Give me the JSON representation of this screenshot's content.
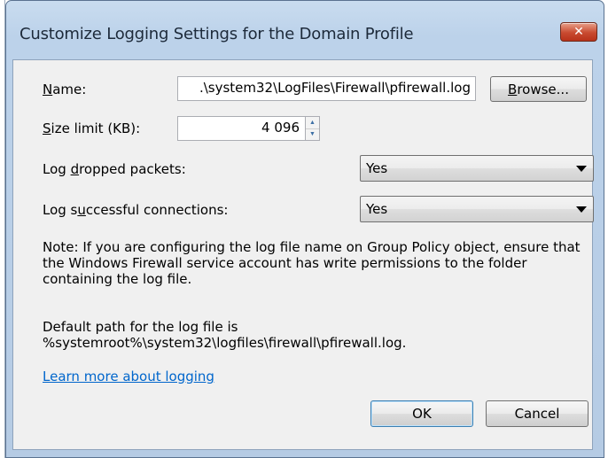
{
  "window": {
    "title": "Customize Logging Settings for the Domain Profile",
    "close_glyph": "✕"
  },
  "name": {
    "label_pre": "",
    "label_u": "N",
    "label_post": "ame:",
    "value": ".\\system32\\LogFiles\\Firewall\\pfirewall.log",
    "browse_u": "B",
    "browse_rest": "rowse..."
  },
  "size_limit": {
    "label_u": "S",
    "label_post": "ize limit (KB):",
    "value": "4 096"
  },
  "log_dropped": {
    "label_pre": "Log ",
    "label_u": "d",
    "label_post": "ropped packets:",
    "selected": "Yes"
  },
  "log_success": {
    "label_pre": "Log s",
    "label_u": "u",
    "label_post": "ccessful connections:",
    "selected": "Yes"
  },
  "note": "Note: If you are configuring the log file name on Group Policy object, ensure that the Windows Firewall service account has write permissions to the folder containing the log file.",
  "default_path_line1": "Default path for the log file is",
  "default_path_line2": "%systemroot%\\system32\\logfiles\\firewall\\pfirewall.log.",
  "learn_more": "Learn more about logging",
  "buttons": {
    "ok": "OK",
    "cancel": "Cancel"
  },
  "colors": {
    "link": "#0066cc",
    "close": "#c94a30",
    "accent_border": "#3c7fb1"
  }
}
